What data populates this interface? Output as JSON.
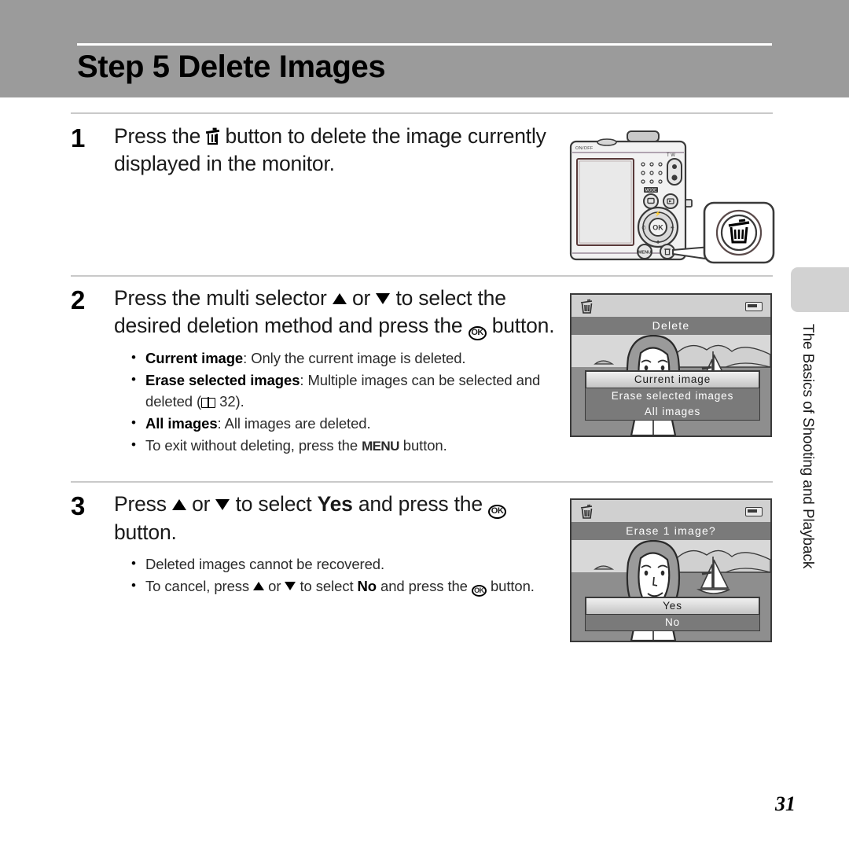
{
  "header": {
    "title": "Step 5 Delete Images"
  },
  "steps": [
    {
      "number": "1",
      "head_pre": "Press the ",
      "head_mid": " button to delete the image currently displayed in the monitor.",
      "bullets": []
    },
    {
      "number": "2",
      "head_a": "Press the multi selector ",
      "head_b": " or ",
      "head_c": " to select the desired deletion method and press the ",
      "head_d": " button.",
      "bullets": [
        {
          "bold": "Current image",
          "rest": ": Only the current image is deleted."
        },
        {
          "bold": "Erase selected images",
          "rest": ": Multiple images can be selected and deleted (",
          "page_ref": "32",
          "tail": ")."
        },
        {
          "bold": "All images",
          "rest": ": All images are deleted."
        },
        {
          "bold": "",
          "rest": "To exit without deleting, press the ",
          "menu": "MENU",
          "tail": " button."
        }
      ]
    },
    {
      "number": "3",
      "head_a": "Press ",
      "head_b": " or ",
      "head_c": " to select ",
      "head_yes": "Yes",
      "head_d": " and press the ",
      "head_e": " button.",
      "bullets": [
        {
          "rest": "Deleted images cannot be recovered."
        },
        {
          "pre": "To cancel, press ",
          "mid": " or ",
          "post": " to select ",
          "bold_no": "No",
          "tail": " and press the ",
          "tail2": " button."
        }
      ]
    }
  ],
  "monitor1": {
    "title": "Delete",
    "items": [
      {
        "label": "Current image",
        "selected": true
      },
      {
        "label": "Erase selected images",
        "selected": false
      },
      {
        "label": "All images",
        "selected": false
      }
    ]
  },
  "monitor2": {
    "title": "Erase 1 image?",
    "items": [
      {
        "label": "Yes",
        "selected": true
      },
      {
        "label": "No",
        "selected": false
      }
    ]
  },
  "camera": {
    "labels": {
      "power": "ON/OFF",
      "mode": "MODE",
      "ok": "OK",
      "menu": "MENU"
    }
  },
  "side_tab": {
    "label": "The Basics of Shooting and Playback"
  },
  "footer": {
    "page_number": "31"
  },
  "colors": {
    "header_band": "#9b9b9b",
    "rule": "#c9c9c9",
    "side_tab": "#d2d2d2",
    "monitor_bg": "#8e8e8e",
    "monitor_titlebar": "#7a7a7a"
  }
}
